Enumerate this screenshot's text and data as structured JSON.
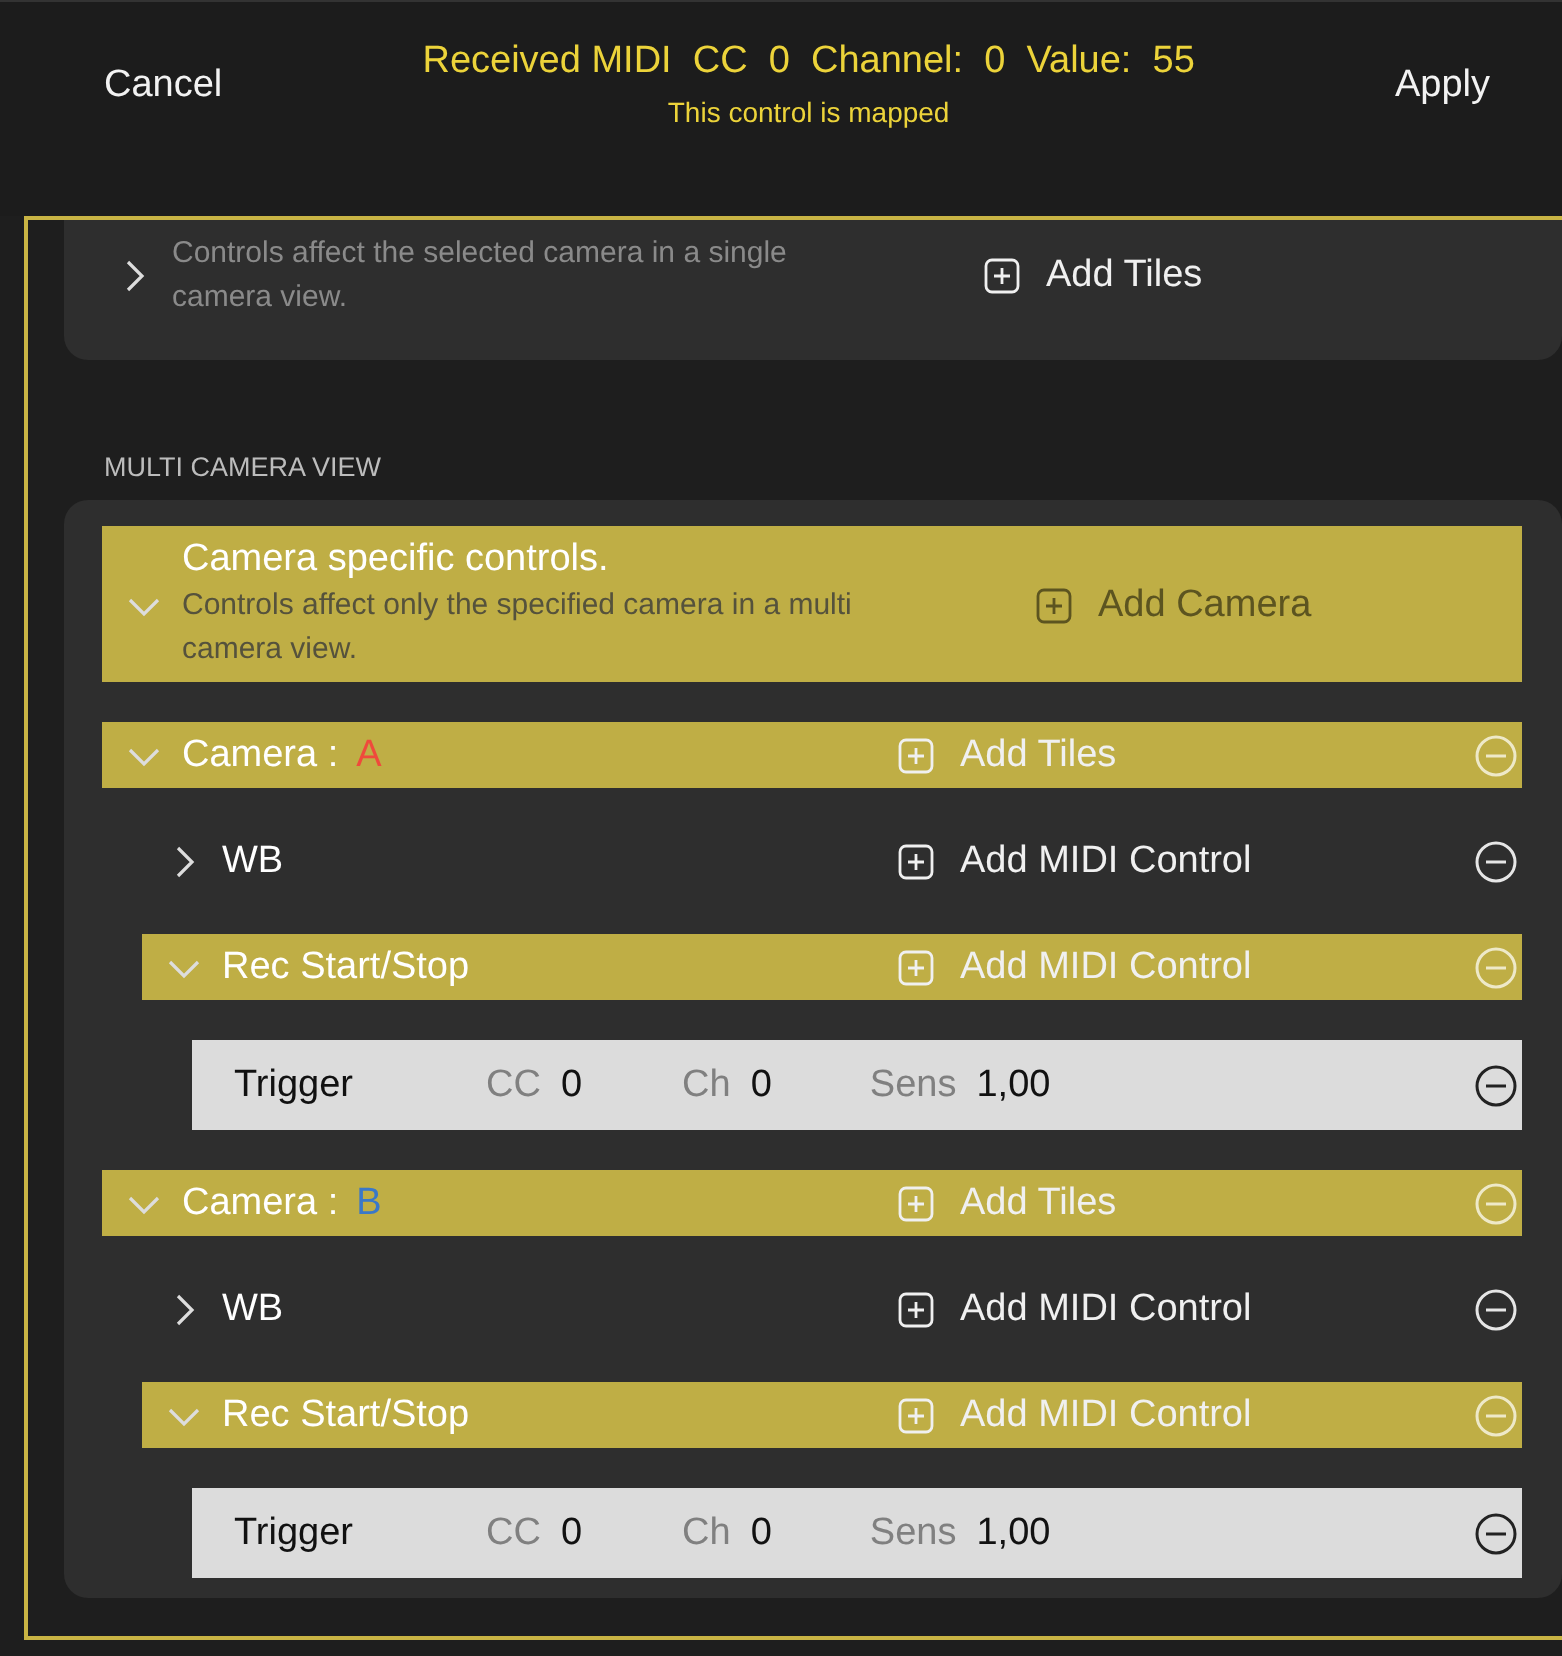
{
  "header": {
    "cancel": "Cancel",
    "title": "Received MIDI  CC  0  Channel:  0  Value:  55",
    "subtitle": "This control is mapped",
    "apply": "Apply"
  },
  "single_camera": {
    "expanded": false,
    "description": "Controls affect the selected camera in a single camera view.",
    "action": {
      "label": "Add Tiles",
      "disabled": false
    }
  },
  "multi_camera": {
    "section_label": "MULTI CAMERA VIEW",
    "group": {
      "title": "Camera specific controls.",
      "description": "Controls affect only the specified camera in a multi camera view.",
      "expanded": true,
      "highlighted": true,
      "action": {
        "label": "Add Camera",
        "disabled": true
      }
    },
    "cameras": [
      {
        "label": "Camera :",
        "letter": "A",
        "color": "#ef4a3c",
        "expanded": true,
        "highlighted": true,
        "action": {
          "label": "Add Tiles",
          "disabled": false
        },
        "children": [
          {
            "label": "WB",
            "expanded": false,
            "highlighted": false,
            "action": {
              "label": "Add MIDI Control",
              "disabled": false
            }
          },
          {
            "label": "Rec Start/Stop",
            "expanded": true,
            "highlighted": true,
            "action": {
              "label": "Add MIDI Control",
              "disabled": false
            },
            "children": [
              {
                "name": "Trigger",
                "cc_label": "CC",
                "cc": "0",
                "ch_label": "Ch",
                "ch": "0",
                "sens_label": "Sens",
                "sens": "1,00"
              }
            ]
          }
        ]
      },
      {
        "label": "Camera :",
        "letter": "B",
        "color": "#3a78c8",
        "expanded": true,
        "highlighted": true,
        "action": {
          "label": "Add Tiles",
          "disabled": false
        },
        "children": [
          {
            "label": "WB",
            "expanded": false,
            "highlighted": false,
            "action": {
              "label": "Add MIDI Control",
              "disabled": false
            }
          },
          {
            "label": "Rec Start/Stop",
            "expanded": true,
            "highlighted": true,
            "action": {
              "label": "Add MIDI Control",
              "disabled": false
            },
            "children": [
              {
                "name": "Trigger",
                "cc_label": "CC",
                "cc": "0",
                "ch_label": "Ch",
                "ch": "0",
                "sens_label": "Sens",
                "sens": "1,00"
              }
            ]
          }
        ]
      }
    ]
  }
}
